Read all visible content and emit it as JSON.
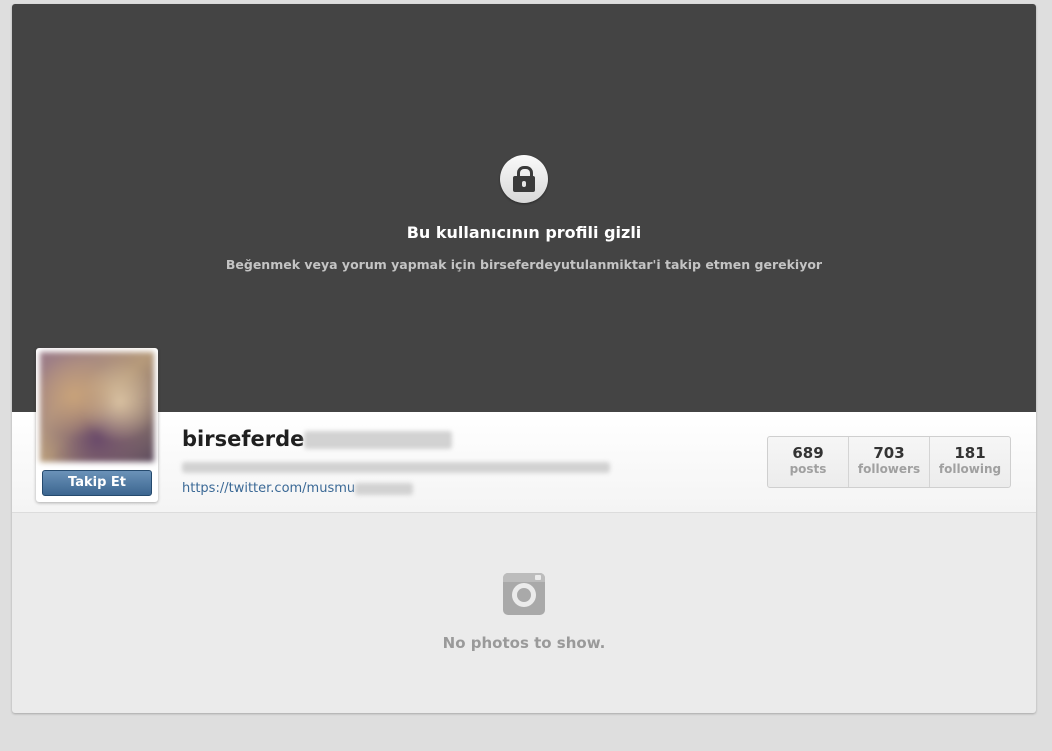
{
  "private_notice": {
    "icon": "lock-icon",
    "title": "Bu kullanıcının profili gizli",
    "subtitle": "Beğenmek veya yorum yapmak için birseferdeyutulanmiktar'i takip etmen gerekiyor"
  },
  "profile": {
    "username_visible": "birseferde",
    "link_visible": "https://twitter.com/musmu",
    "follow_label": "Takip Et"
  },
  "stats": [
    {
      "value": "689",
      "label": "posts"
    },
    {
      "value": "703",
      "label": "followers"
    },
    {
      "value": "181",
      "label": "following"
    }
  ],
  "empty_state": {
    "icon": "camera-icon",
    "text": "No photos to show."
  }
}
